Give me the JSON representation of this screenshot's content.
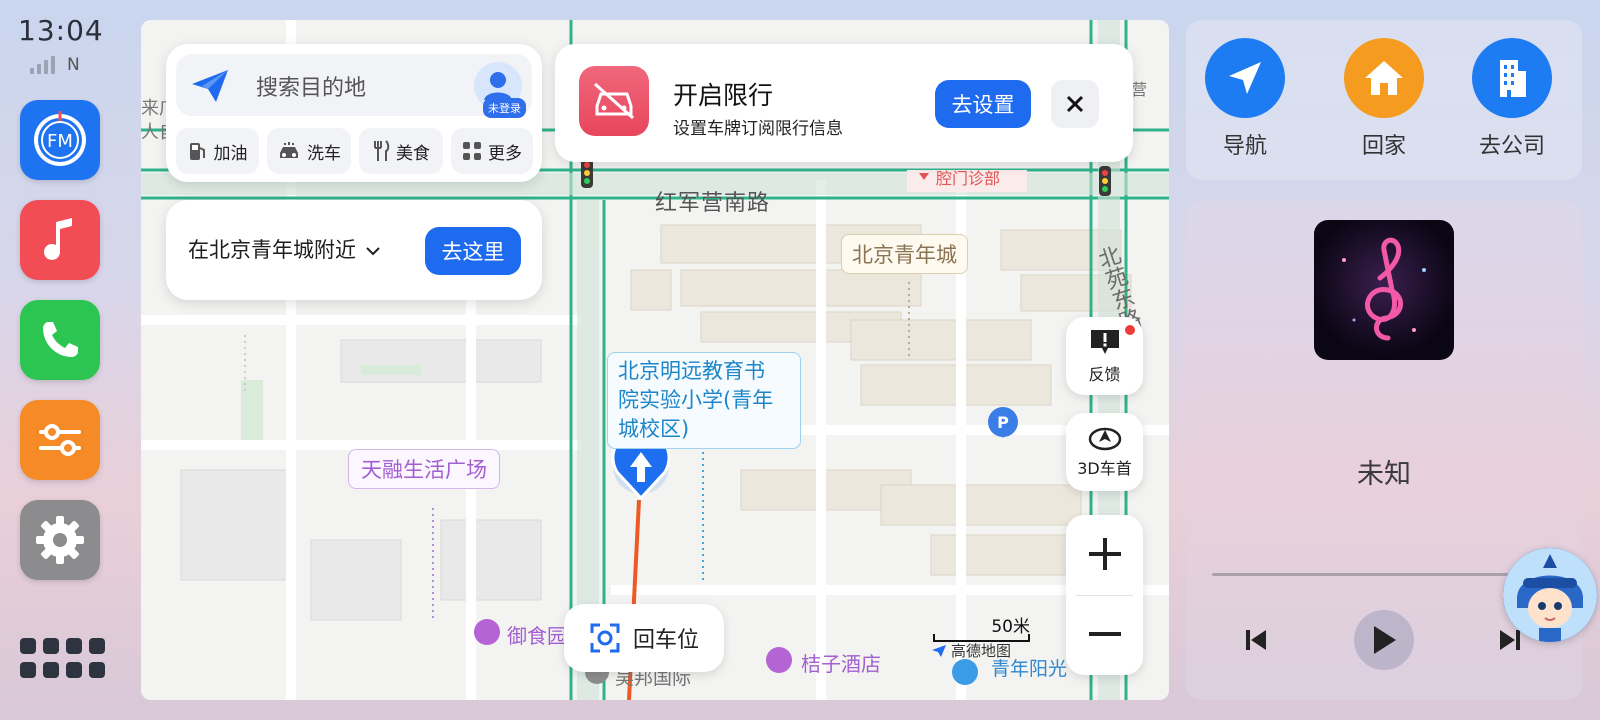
{
  "status": {
    "time": "13:04",
    "network": "N"
  },
  "dock": {
    "apps": [
      {
        "name": "fm-radio",
        "label": "FM",
        "color": "#1e74f0"
      },
      {
        "name": "music",
        "color": "#f24c54"
      },
      {
        "name": "phone",
        "color": "#2dc552"
      },
      {
        "name": "car-controls",
        "color": "#f58a27"
      },
      {
        "name": "settings",
        "color": "#8c8c8f"
      }
    ]
  },
  "map": {
    "search": {
      "placeholder": "搜索目的地",
      "login_badge": "未登录"
    },
    "chips": [
      {
        "label": "加油",
        "icon": "gas-station-icon"
      },
      {
        "label": "洗车",
        "icon": "car-wash-icon"
      },
      {
        "label": "美食",
        "icon": "food-icon"
      },
      {
        "label": "更多",
        "icon": "more-grid-icon"
      }
    ],
    "nearby": {
      "text": "在北京青年城附近",
      "button": "去这里"
    },
    "restriction": {
      "title": "开启限行",
      "subtitle": "设置车牌订阅限行信息",
      "button": "去设置"
    },
    "side_buttons": {
      "feedback": "反馈",
      "heading_mode": "3D车首"
    },
    "recenter_label": "回车位",
    "scale_label": "50米",
    "brand": "高德地图",
    "labels": {
      "street_south": "红军营南路",
      "street_east": "北苑东路",
      "qingniancheng": "北京青年城",
      "school": "北京明远教育书院实验小学(青年城校区)",
      "school_l1": "北京明远教育书",
      "school_l2": "院实验小学(青年",
      "school_l3": "城校区)",
      "tianrong": "天融生活广场",
      "yushiyuan": "御食园",
      "juzi_hotel": "桔子酒店",
      "yibang": "吴邦国际",
      "qingnian_yangguang": "青年阳光",
      "clinic": "腔门诊部",
      "ying": "营",
      "left_frag1": "来广",
      "left_frag2": "人自"
    }
  },
  "shortcuts": [
    {
      "label": "导航",
      "icon": "navigation-arrow-icon",
      "color": "#1d7cf2"
    },
    {
      "label": "回家",
      "icon": "home-icon",
      "color": "#f59b1f"
    },
    {
      "label": "去公司",
      "icon": "office-building-icon",
      "color": "#1d7cf2"
    }
  ],
  "music": {
    "title": "未知",
    "progress": 0
  }
}
